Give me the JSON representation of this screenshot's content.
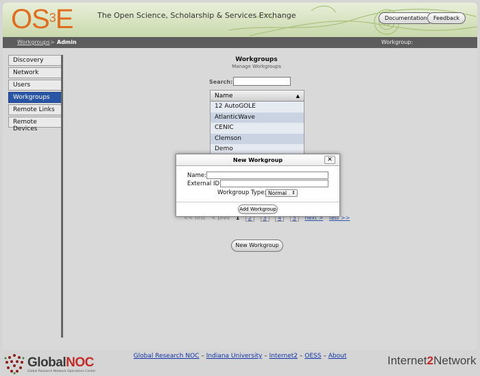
{
  "header": {
    "logo_text": "OS",
    "logo_sup": "3",
    "logo_text2": "E",
    "tagline": "The Open Science, Scholarship & Services Exchange",
    "buttons": {
      "documentation": "Documentation",
      "feedback": "Feedback"
    }
  },
  "breadcrumb": {
    "parent": "Workgroups",
    "sep": ">",
    "current": "Admin",
    "workgroup_label": "Workgroup:"
  },
  "sidebar": {
    "items": [
      {
        "label": "Discovery"
      },
      {
        "label": "Network"
      },
      {
        "label": "Users"
      },
      {
        "label": "Workgroups"
      },
      {
        "label": "Remote Links"
      },
      {
        "label": "Remote Devices"
      }
    ],
    "active_index": 3,
    "active_color": "#2855a6"
  },
  "main": {
    "title": "Workgroups",
    "subtitle": "Manage Workgroups",
    "search_label": "Search:",
    "table": {
      "header": "Name",
      "sort_glyph": "▲",
      "rows": [
        "12 AutoGOLE",
        "AtlanticWave",
        "CENIC",
        "Clemson",
        "Demo"
      ]
    },
    "pager": {
      "first": "<< first",
      "prev": "< prev",
      "current": "1",
      "pages": [
        "2",
        "3",
        "4",
        "5"
      ],
      "next": "next >",
      "last": "last >>"
    },
    "new_button": "New Workgroup"
  },
  "modal": {
    "title": "New Workgroup",
    "close_glyph": "✕",
    "name_label": "Name:",
    "external_id_label": "External ID:",
    "type_label": "Workgroup Type:",
    "type_value": "Normal",
    "submit": "Add Workgroup"
  },
  "footer": {
    "links": [
      "Global Research NOC",
      "Indiana University",
      "Internet2",
      "OESS",
      "About"
    ],
    "sep": "–",
    "gnoc_a": "Global",
    "gnoc_b": "NOC",
    "gnoc_sub": "Global Research Network Operations Center",
    "i2_a": "Internet",
    "i2_slash": "2",
    "i2_b": "Network"
  }
}
